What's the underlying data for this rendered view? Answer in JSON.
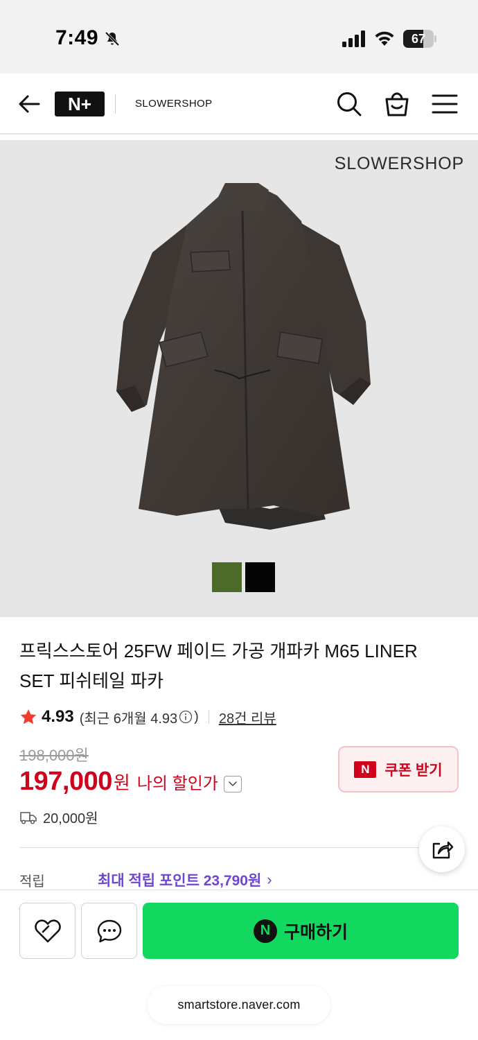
{
  "status_bar": {
    "time": "7:49",
    "battery_level": "67"
  },
  "header": {
    "logo_text": "N+",
    "store_name": "SLOWERSHOP"
  },
  "product_image": {
    "brand_watermark": "SLOWERSHOP",
    "color_swatches": [
      {
        "color": "#4c6b2a"
      },
      {
        "color": "#050505"
      }
    ]
  },
  "product": {
    "title": "프릭스스토어 25FW 페이드 가공 개파카 M65 LINER SET 피쉬테일 파카",
    "rating": "4.93",
    "rating_recent": "(최근 6개월 4.93",
    "rating_recent_close": ")",
    "review_count": "28건 리뷰",
    "original_price": "198,000원",
    "sale_price": "197,000",
    "sale_unit": "원",
    "my_discount_label": "나의 할인가",
    "shipping_fee": "20,000원"
  },
  "coupon": {
    "badge": "N",
    "label": "쿠폰 받기"
  },
  "points": {
    "label": "적립",
    "link_text": "최대 적립 포인트 23,790원",
    "chevron": "›"
  },
  "bottom_bar": {
    "buy_badge": "N",
    "buy_label": "구매하기",
    "url": "smartstore.naver.com"
  },
  "colors": {
    "accent_red": "#d0021b",
    "buy_green": "#12d85f",
    "points_purple": "#6f45d6"
  }
}
